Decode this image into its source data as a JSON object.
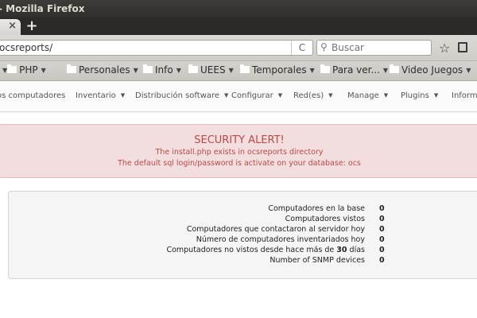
{
  "window": {
    "title": "- Mozilla Firefox"
  },
  "tabs": {
    "close_glyph": "×",
    "new_tab_glyph": "+"
  },
  "urlbar": {
    "url": "ocsreports/",
    "reload_glyph": "C"
  },
  "search": {
    "placeholder": "Buscar"
  },
  "bookmarks": [
    {
      "label": "PHP"
    },
    {
      "label": "Personales"
    },
    {
      "label": "Info"
    },
    {
      "label": "UEES"
    },
    {
      "label": "Temporales"
    },
    {
      "label": "Para ver..."
    },
    {
      "label": "Video Juegos"
    }
  ],
  "app_nav": [
    {
      "label": "os computadores",
      "dropdown": false
    },
    {
      "label": "Inventario",
      "dropdown": true
    },
    {
      "label": "Distribución software",
      "dropdown": true
    },
    {
      "label": "Configurar",
      "dropdown": true
    },
    {
      "label": "Red(es)",
      "dropdown": true
    },
    {
      "label": "Manage",
      "dropdown": true
    },
    {
      "label": "Plugins",
      "dropdown": true
    },
    {
      "label": "Informa",
      "dropdown": false
    }
  ],
  "alert": {
    "heading": "SECURITY ALERT!",
    "line1": "The install.php exists in ocsreports directory",
    "line2": "The default sql login/password is activate on your database: ocs",
    "color": "#b94a48"
  },
  "stats": [
    {
      "label": "Computadores en la base",
      "value": "0"
    },
    {
      "label": "Computadores vistos",
      "value": "0"
    },
    {
      "label": "Computadores que contactaron al servidor hoy",
      "value": "0"
    },
    {
      "label": "Número de computadores inventariados hoy",
      "value": "0"
    },
    {
      "label_before": "Computadores no vistos desde hace más de",
      "days": "30",
      "label_after": "días",
      "value": "0"
    },
    {
      "label": "Number of SNMP devices",
      "value": "0"
    }
  ]
}
